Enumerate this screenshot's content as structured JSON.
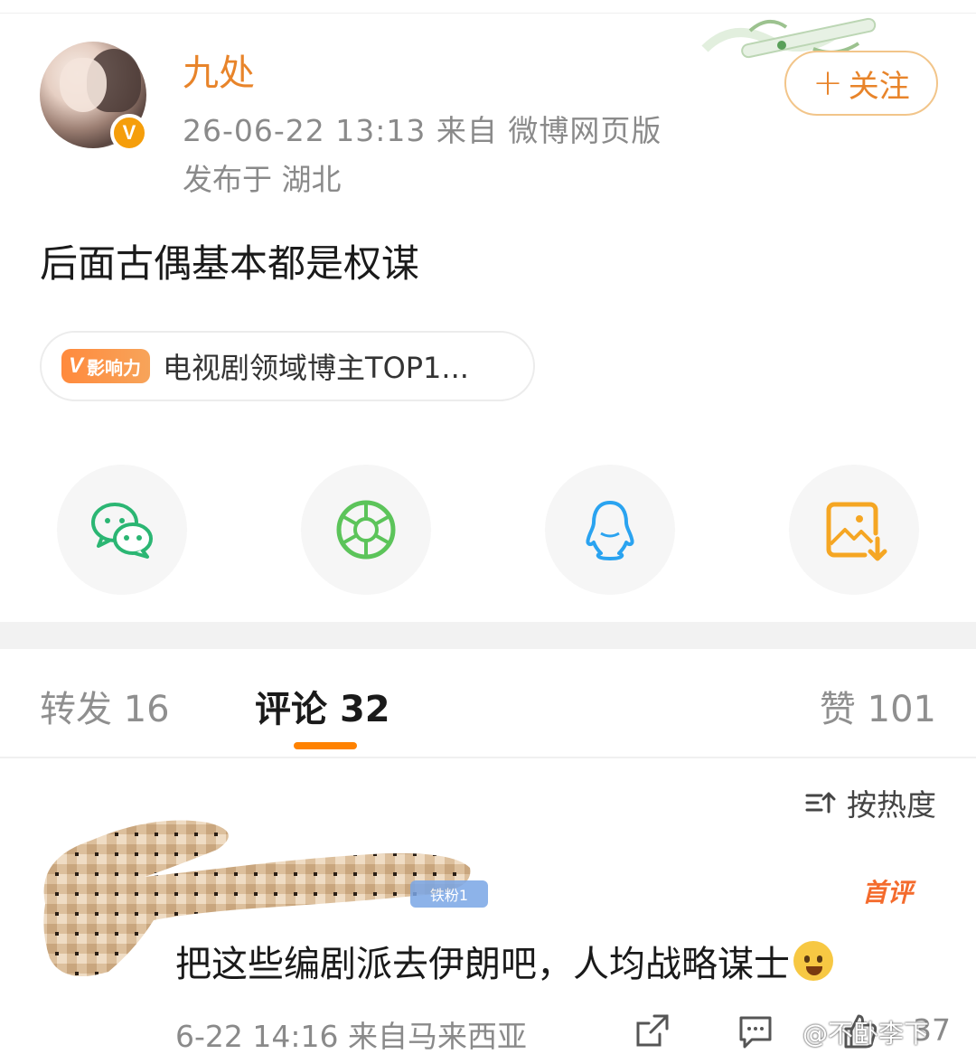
{
  "post": {
    "username": "九处",
    "verified_badge": "V",
    "meta_time_source": "26-06-22 13:13  来自 微博网页版",
    "meta_location": "发布于 湖北",
    "follow_label": "关注",
    "follow_plus": "+",
    "text": "后面古偶基本都是权谋"
  },
  "influence": {
    "badge_v": "V",
    "badge_text": "影响力",
    "text": "电视剧领域博主TOP1..."
  },
  "share": {
    "icons": [
      "wechat-icon",
      "moments-icon",
      "qq-icon",
      "save-image-icon"
    ],
    "colors": {
      "wechat": "#2bb673",
      "moments": "#5cc45a",
      "qq": "#2aa3f0",
      "save": "#f5a623"
    }
  },
  "tabs": {
    "repost_label": "转发",
    "repost_count": "16",
    "comment_label": "评论",
    "comment_count": "32",
    "like_label": "赞",
    "like_count": "101"
  },
  "sort": {
    "label": "按热度"
  },
  "comment": {
    "fan_badge": "铁粉1",
    "first_label": "首评",
    "text": "把这些编剧派去伊朗吧，人均战略谋士",
    "emoji": "crying-face-icon",
    "meta": "6-22 14:16 来自马来西亚",
    "like_count": "37"
  },
  "watermark": "@不卧李下",
  "accent_color": "#ff8200"
}
